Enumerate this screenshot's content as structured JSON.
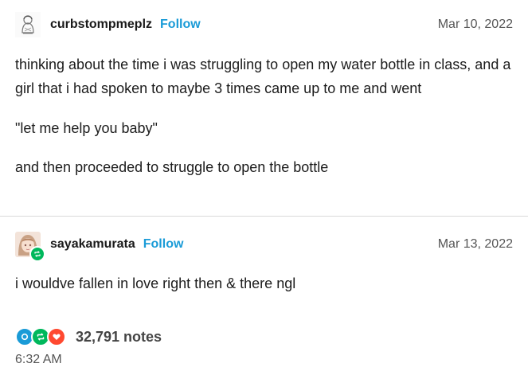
{
  "post1": {
    "username": "curbstompmeplz",
    "follow_label": "Follow",
    "date": "Mar 10, 2022",
    "paragraphs": [
      "thinking about the time i was struggling to open my water bottle in class, and a girl that i had spoken to maybe 3 times came up to me and went",
      "\"let me help you baby\"",
      "and then proceeded to struggle to open the bottle"
    ]
  },
  "post2": {
    "username": "sayakamurata",
    "follow_label": "Follow",
    "date": "Mar 13, 2022",
    "paragraphs": [
      "i wouldve fallen in love right then & there ngl"
    ]
  },
  "footer": {
    "notes": "32,791 notes",
    "time": "6:32 AM",
    "icons": [
      "comment-icon",
      "reblog-icon",
      "like-icon"
    ]
  },
  "colors": {
    "follow": "#1a9bd7",
    "comment": "#1a9bd7",
    "reblog": "#00b85c",
    "like": "#ff4930"
  }
}
